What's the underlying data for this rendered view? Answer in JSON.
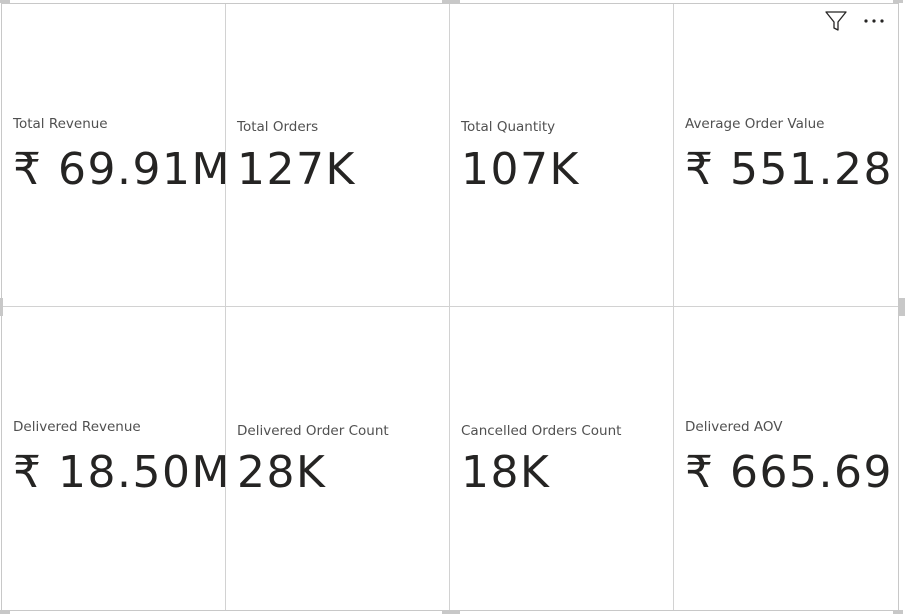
{
  "header": {
    "filter_icon": "filter-icon",
    "more_options_icon": "more-options-icon"
  },
  "cards": [
    {
      "label": "Total Revenue",
      "value": "₹ 69.91M"
    },
    {
      "label": "Total Orders",
      "value": "127K"
    },
    {
      "label": "Total Quantity",
      "value": "107K"
    },
    {
      "label": "Average Order Value",
      "value": "₹ 551.28"
    },
    {
      "label": "Delivered Revenue",
      "value": "₹ 18.50M"
    },
    {
      "label": "Delivered Order Count",
      "value": "28K"
    },
    {
      "label": "Cancelled Orders Count",
      "value": "18K"
    },
    {
      "label": "Delivered AOV",
      "value": "₹ 665.69"
    }
  ],
  "colors": {
    "value_text": "#252423",
    "label_text": "#505050",
    "divider": "#d2d2d2"
  }
}
